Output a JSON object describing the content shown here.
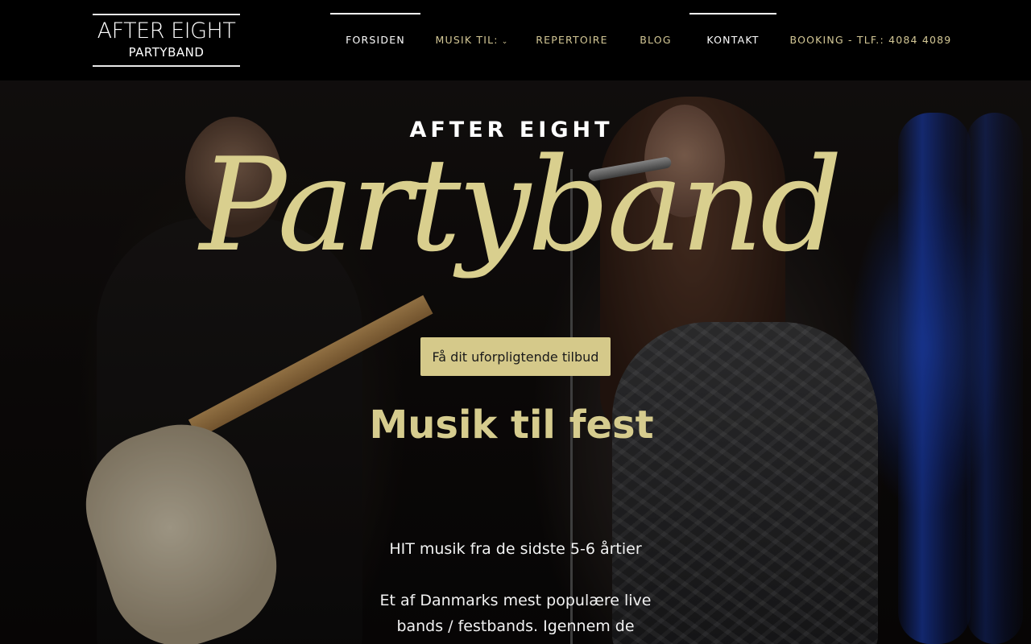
{
  "logo": {
    "line1": "AFTER EIGHT",
    "line2": "PARTYBAND"
  },
  "nav": {
    "items": [
      {
        "label": "FORSIDEN",
        "active": true
      },
      {
        "label": "MUSIK TIL:",
        "has_dropdown": true,
        "caret": "⌄"
      },
      {
        "label": "REPERTOIRE"
      },
      {
        "label": "BLOG"
      },
      {
        "label": "KONTAKT",
        "active": true
      },
      {
        "label": "BOOKING - TLF.: 4084 4089"
      }
    ]
  },
  "hero": {
    "kicker": "AFTER EIGHT",
    "script_title": "Partyband",
    "cta_label": "Få dit uforpligtende tilbud",
    "heading": "Musik til fest",
    "paragraph1": "HIT musik fra de sidste 5-6 årtier",
    "paragraph2": "Et af Danmarks mest populære live bands / festbands. Igennem de"
  },
  "colors": {
    "accent_gold": "#d5c98a",
    "nav_gold": "#d4c896",
    "header_bg": "#000000"
  }
}
